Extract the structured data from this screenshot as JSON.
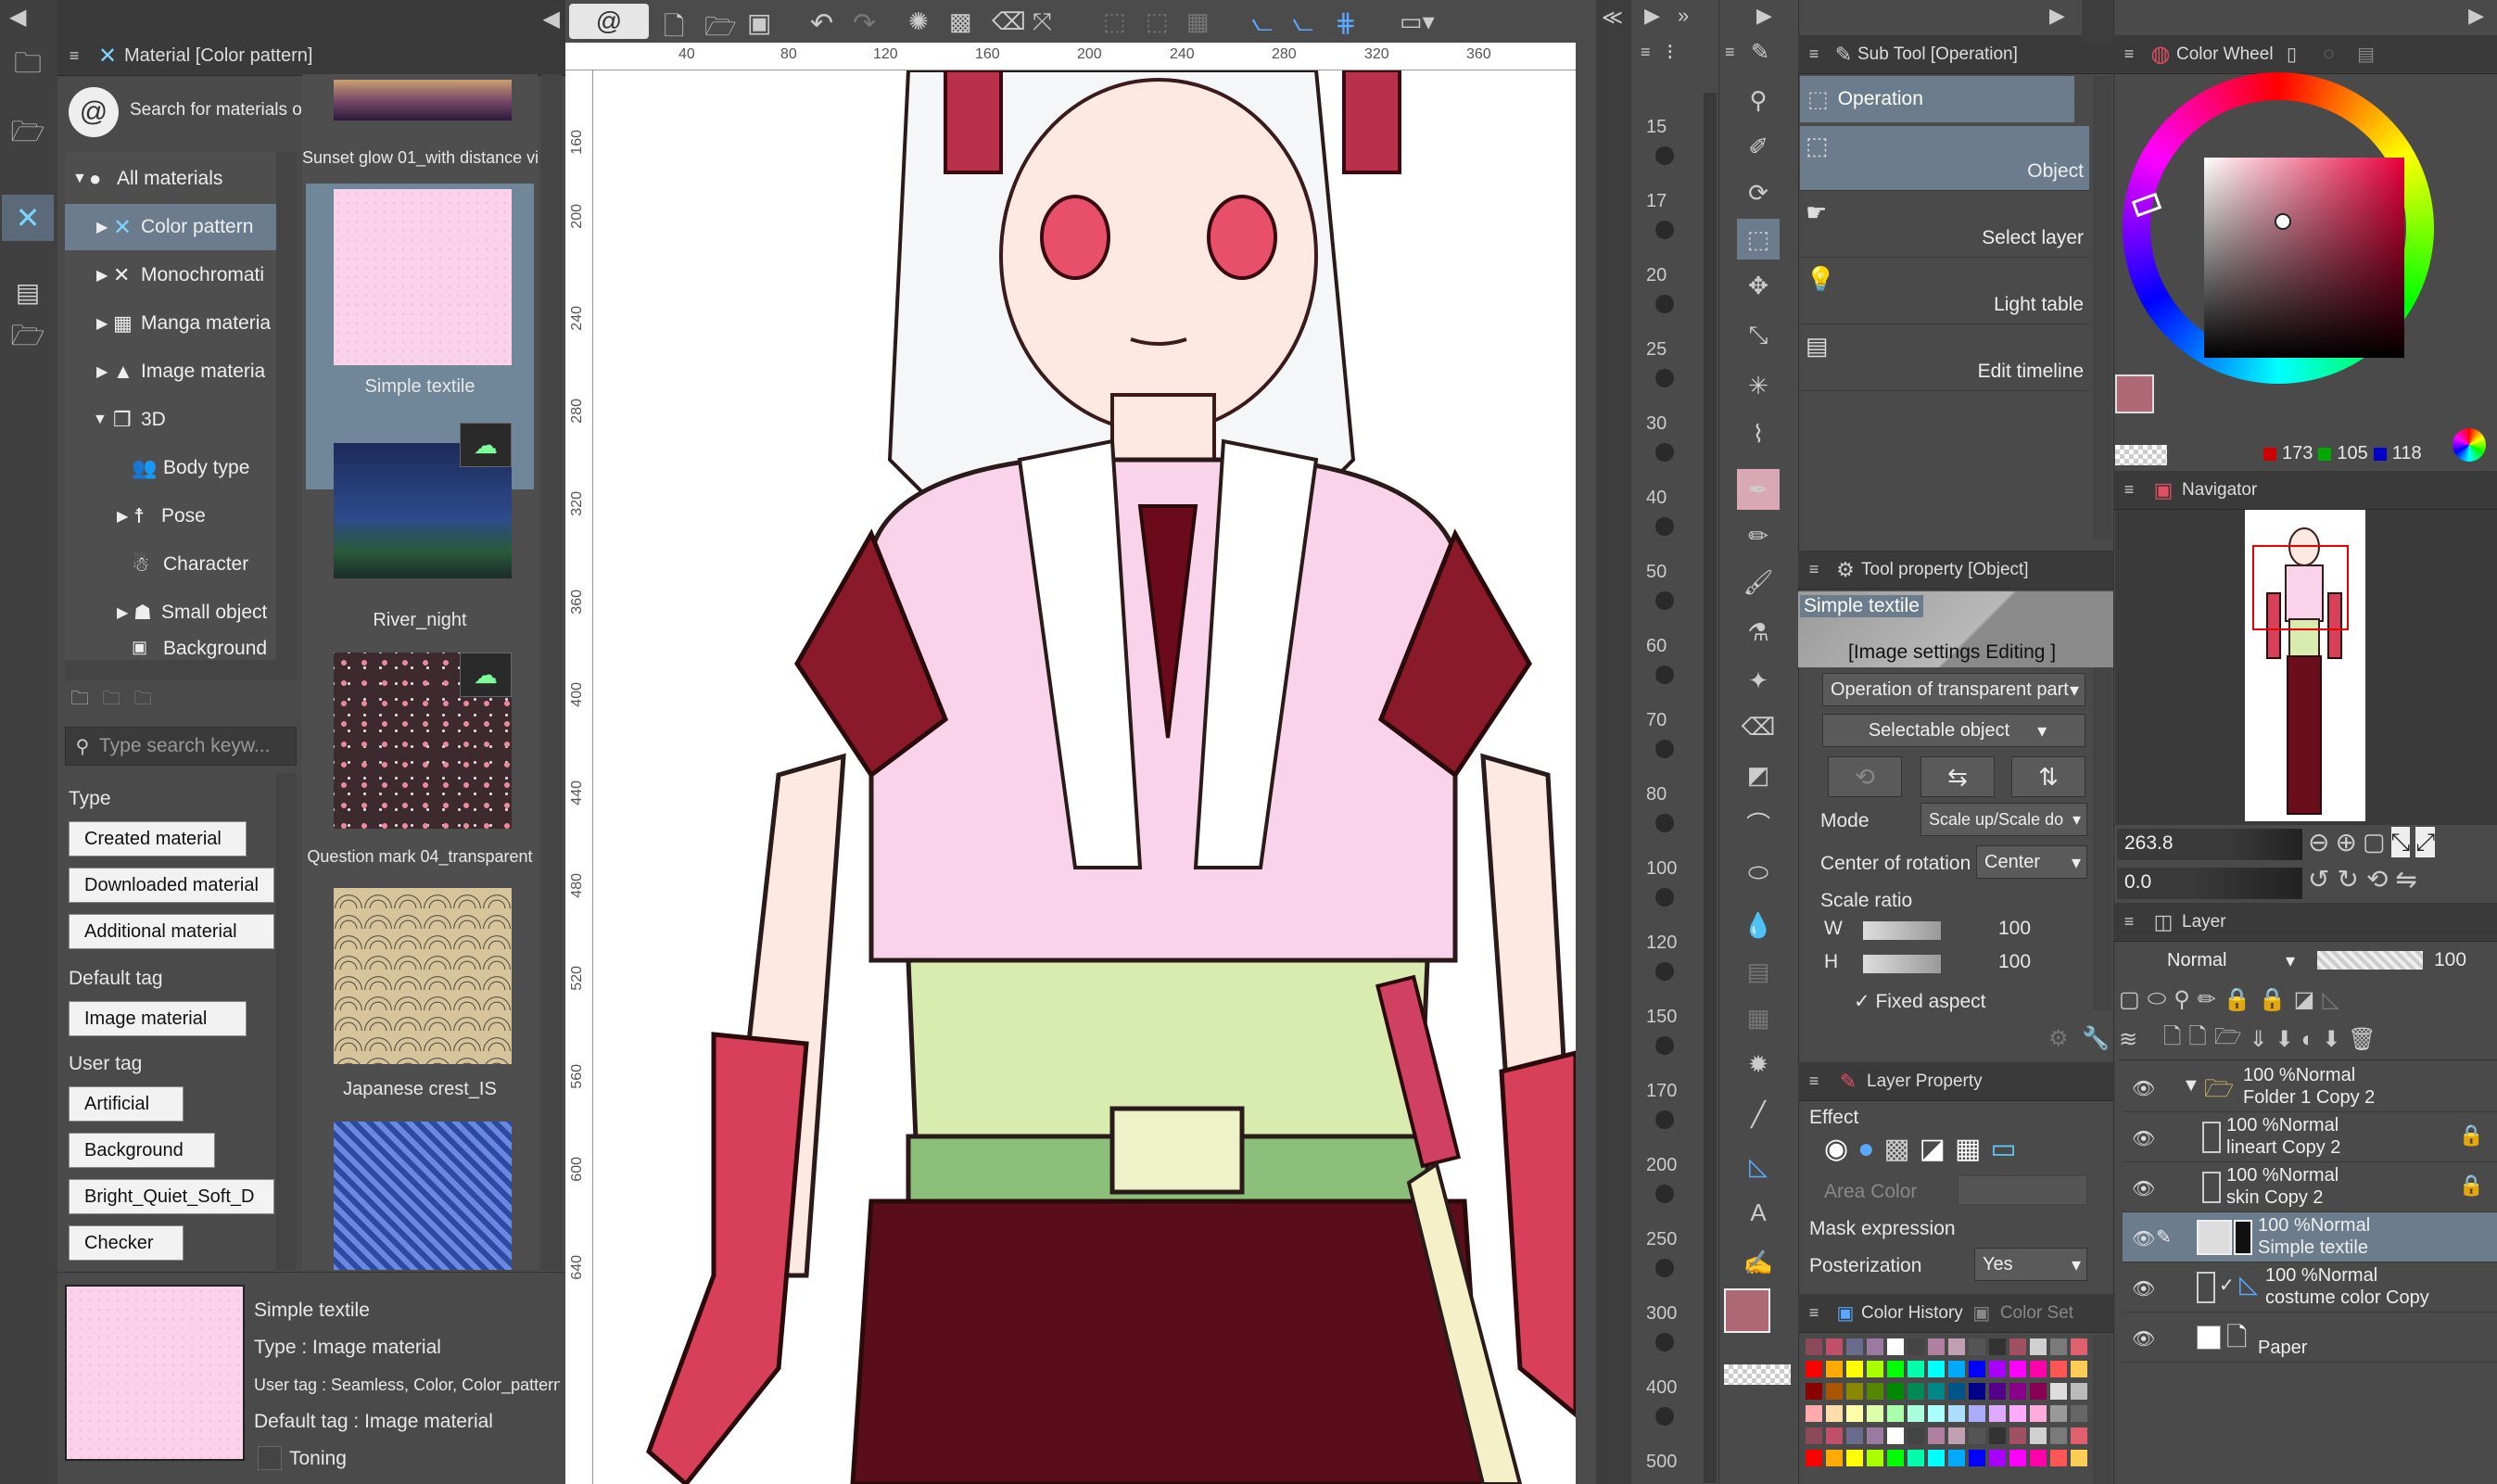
{
  "material_panel": {
    "title": "Material [Color pattern]",
    "search_online": "Search for materials on",
    "tree": [
      {
        "label": "All materials"
      },
      {
        "label": "Color pattern"
      },
      {
        "label": "Monochromati"
      },
      {
        "label": "Manga materia"
      },
      {
        "label": "Image materia"
      },
      {
        "label": "3D"
      },
      {
        "label": "Body type"
      },
      {
        "label": "Pose"
      },
      {
        "label": "Character"
      },
      {
        "label": "Small object"
      },
      {
        "label": "Background"
      }
    ],
    "search_placeholder": "Type search keyw...",
    "type_heading": "Type",
    "type_tags": [
      "Created material",
      "Downloaded material",
      "Additional material"
    ],
    "default_tag_heading": "Default tag",
    "default_tags": [
      "Image material"
    ],
    "user_tag_heading": "User tag",
    "user_tags": [
      "Artificial",
      "Background",
      "Bright_Quiet_Soft_D",
      "Checker"
    ],
    "thumbnails": [
      {
        "caption": "Sunset glow 01_with distance vi"
      },
      {
        "caption": "Simple textile"
      },
      {
        "caption": "River_night"
      },
      {
        "caption": "Question mark 04_transparent"
      },
      {
        "caption": "Japanese crest_IS"
      }
    ],
    "detail": {
      "name": "Simple textile",
      "type": "Type : Image material",
      "user_tag": "User tag : Seamless, Color, Color_pattern, Pa",
      "default_tag": "Default tag : Image material",
      "toning": "Toning"
    }
  },
  "ruler": {
    "top": [
      "40",
      "80",
      "120",
      "160",
      "200",
      "240",
      "280",
      "320",
      "360"
    ],
    "left": [
      "160",
      "200",
      "240",
      "280",
      "320",
      "360",
      "400",
      "440",
      "480",
      "520",
      "560",
      "600",
      "640"
    ]
  },
  "size_slider": {
    "values": [
      "15",
      "17",
      "20",
      "25",
      "30",
      "40",
      "50",
      "60",
      "70",
      "80",
      "100",
      "120",
      "150",
      "170",
      "200",
      "250",
      "300",
      "400",
      "500"
    ]
  },
  "subtool": {
    "title": "Sub Tool [Operation]",
    "group": "Operation",
    "items": [
      "Object",
      "Select layer",
      "Light table",
      "Edit timeline"
    ]
  },
  "tool_property": {
    "title": "Tool property [Object]",
    "object_name": "Simple textile",
    "image_settings": "[Image settings Editing ]",
    "transparent_op": "Operation of transparent part",
    "selectable": "Selectable object",
    "mode_label": "Mode",
    "mode_value": "Scale up/Scale do",
    "center_label": "Center of rotation",
    "center_value": "Center",
    "scale_label": "Scale ratio",
    "w_label": "W",
    "w_value": "100",
    "h_label": "H",
    "h_value": "100",
    "fixed_aspect": "Fixed aspect"
  },
  "layer_property": {
    "title": "Layer Property",
    "effect": "Effect",
    "area_color": "Area Color",
    "mask_expression": "Mask expression",
    "posterization": "Posterization",
    "posterization_value": "Yes"
  },
  "color_history": {
    "tab1": "Color History",
    "tab2": "Color Set"
  },
  "color_wheel": {
    "title": "Color Wheel",
    "r": "173",
    "g": "105",
    "b": "118",
    "main_color": "#ad6976"
  },
  "navigator": {
    "title": "Navigator",
    "zoom": "263.8",
    "angle": "0.0"
  },
  "layer_panel": {
    "title": "Layer",
    "blend": "Normal",
    "opacity": "100",
    "layers": [
      {
        "mode": "100 %Normal",
        "name": "Folder 1 Copy 2"
      },
      {
        "mode": "100 %Normal",
        "name": "lineart Copy 2"
      },
      {
        "mode": "100 %Normal",
        "name": "skin Copy 2"
      },
      {
        "mode": "100 %Normal",
        "name": "Simple textile"
      },
      {
        "mode": "100 %Normal",
        "name": "costume color Copy"
      },
      {
        "mode": "",
        "name": "Paper"
      }
    ]
  }
}
